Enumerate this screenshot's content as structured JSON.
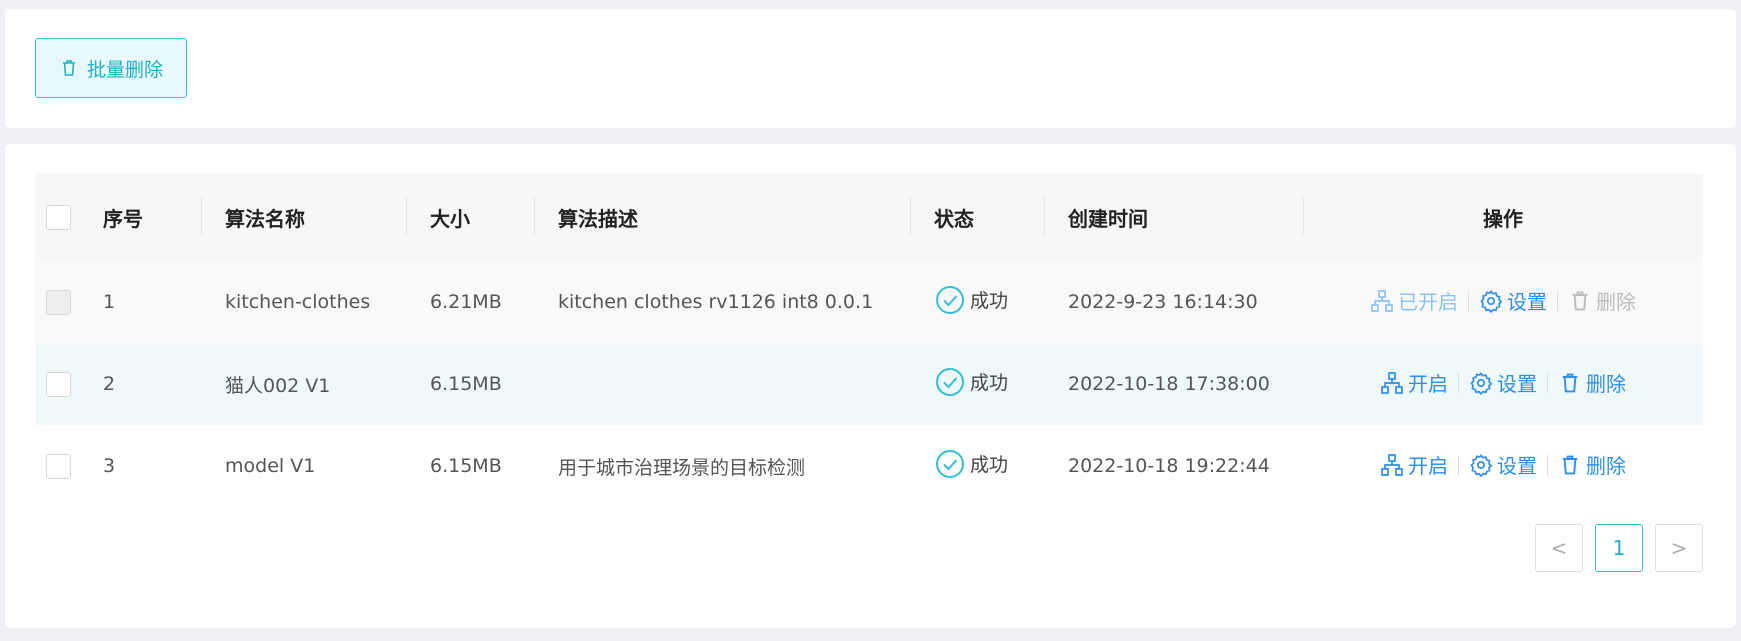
{
  "toolbar": {
    "batch_delete_label": "批量删除"
  },
  "table": {
    "headers": {
      "index": "序号",
      "name": "算法名称",
      "size": "大小",
      "desc": "算法描述",
      "status": "状态",
      "created": "创建时间",
      "actions": "操作"
    },
    "rows": [
      {
        "index": "1",
        "name": "kitchen-clothes",
        "size": "6.21MB",
        "desc": "kitchen clothes rv1126 int8 0.0.1",
        "status": "成功",
        "created": "2022-9-23 16:14:30",
        "toggle": "已开启",
        "settings": "设置",
        "delete": "删除"
      },
      {
        "index": "2",
        "name": "猫人002 V1",
        "size": "6.15MB",
        "desc": "",
        "status": "成功",
        "created": "2022-10-18 17:38:00",
        "toggle": "开启",
        "settings": "设置",
        "delete": "删除"
      },
      {
        "index": "3",
        "name": "model V1",
        "size": "6.15MB",
        "desc": "用于城市治理场景的目标检测",
        "status": "成功",
        "created": "2022-10-18 19:22:44",
        "toggle": "开启",
        "settings": "设置",
        "delete": "删除"
      }
    ]
  },
  "pagination": {
    "prev": "<",
    "current": "1",
    "next": ">"
  },
  "colors": {
    "accent": "#1fb0c2",
    "link": "#2e8ee8",
    "success": "#35c0cf"
  }
}
